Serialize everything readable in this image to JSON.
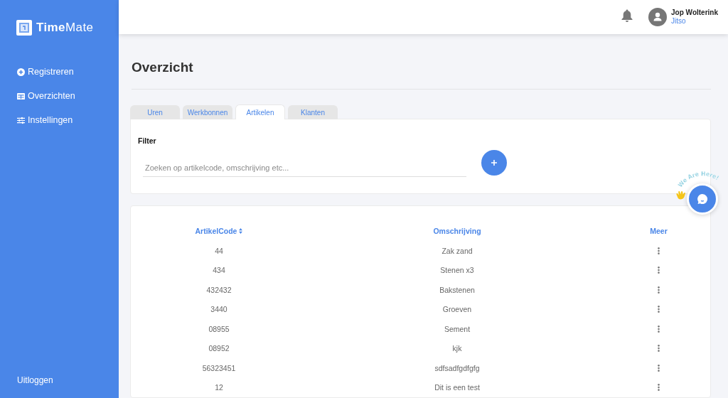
{
  "sidebar": {
    "logo": "**Time**Mate",
    "items": [
      {
        "label": "Registreren"
      },
      {
        "label": "Overzichten"
      },
      {
        "label": "Instellingen"
      }
    ],
    "logout": "Uitloggen"
  },
  "header": {
    "user": {
      "name": "Jop Wolterink",
      "company": "Jitso"
    }
  },
  "page_title": "Overzicht",
  "tabs": [
    {
      "label": "Uren",
      "selected": false
    },
    {
      "label": "Werkbonnen",
      "selected": false
    },
    {
      "label": "Artikelen",
      "selected": true
    },
    {
      "label": "Klanten",
      "selected": false
    }
  ],
  "filter": {
    "label": "Filter",
    "search": {
      "placeholder": "Zoeken op artikelcode, omschrijving etc..."
    }
  },
  "table": {
    "columns": [
      {
        "label": "ArtikelCode",
        "sortable": true
      },
      {
        "label": "Omschrijving",
        "sortable": false
      },
      {
        "label": "Meer",
        "sortable": false
      }
    ],
    "rows": [
      {
        "code": "44",
        "description": "Zak zand"
      },
      {
        "code": "434",
        "description": "Stenen x3"
      },
      {
        "code": "432432",
        "description": "Bakstenen"
      },
      {
        "code": "3440",
        "description": "Groeven"
      },
      {
        "code": "08955",
        "description": "Sement"
      },
      {
        "code": "08952",
        "description": "kjk"
      },
      {
        "code": "56323451",
        "description": "sdfsadfgdfgfg"
      },
      {
        "code": "12",
        "description": "Dit is een test"
      }
    ]
  },
  "chat_widget": {
    "badge": "We Are Here!"
  }
}
